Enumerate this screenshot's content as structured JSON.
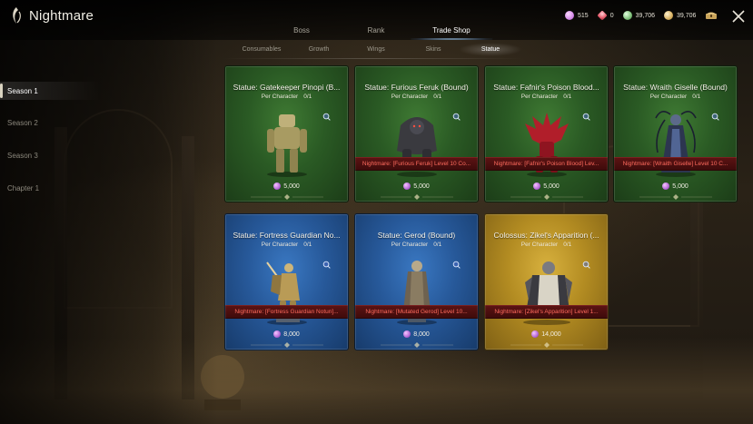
{
  "header": {
    "title": "Nightmare",
    "currencies": [
      {
        "icon": "pink-crystal-icon",
        "value": "515",
        "color": "#d58be8"
      },
      {
        "icon": "red-crystal-icon",
        "value": "0",
        "color": "#e45a6a"
      },
      {
        "icon": "green-coin-icon",
        "value": "39,706",
        "color": "#7fc07a"
      },
      {
        "icon": "gold-coin-icon",
        "value": "39,706",
        "color": "#d7b060"
      }
    ]
  },
  "main_tabs": [
    {
      "label": "Boss",
      "active": false
    },
    {
      "label": "Rank",
      "active": false
    },
    {
      "label": "Trade Shop",
      "active": true
    }
  ],
  "sub_tabs": [
    {
      "label": "Consumables",
      "active": false
    },
    {
      "label": "Growth",
      "active": false
    },
    {
      "label": "Wings",
      "active": false
    },
    {
      "label": "Skins",
      "active": false
    },
    {
      "label": "Statue",
      "active": true
    }
  ],
  "side_nav": [
    {
      "label": "Season 1",
      "active": true
    },
    {
      "label": "Season 2",
      "active": false
    },
    {
      "label": "Season 3",
      "active": false
    },
    {
      "label": "Chapter 1",
      "active": false
    }
  ],
  "items": [
    {
      "name": "Statue: Gatekeeper Pinopi (B...",
      "limit_label": "Per Character",
      "limit": "0/1",
      "requirement": "",
      "price": "5,000",
      "theme": "green",
      "figure": "golem-statue-icon"
    },
    {
      "name": "Statue: Furious Feruk (Bound)",
      "limit_label": "Per Character",
      "limit": "0/1",
      "requirement": "Nightmare: [Furious Feruk] Level 10 Co...",
      "price": "5,000",
      "theme": "green",
      "figure": "beast-statue-icon"
    },
    {
      "name": "Statue: Fafnir's Poison Blood...",
      "limit_label": "Per Character",
      "limit": "0/1",
      "requirement": "Nightmare: [Fafnir's Poison Blood] Lev...",
      "price": "5,000",
      "theme": "green",
      "figure": "red-demon-statue-icon"
    },
    {
      "name": "Statue: Wraith Giselle (Bound)",
      "limit_label": "Per Character",
      "limit": "0/1",
      "requirement": "Nightmare: [Wraith Giselle] Level 10 C...",
      "price": "5,000",
      "theme": "green",
      "figure": "wraith-statue-icon"
    },
    {
      "name": "Statue: Fortress Guardian No...",
      "limit_label": "Per Character",
      "limit": "0/1",
      "requirement": "Nightmare: [Fortress Guardian Notun]...",
      "price": "8,000",
      "theme": "blue",
      "figure": "guardian-statue-icon"
    },
    {
      "name": "Statue: Gerod (Bound)",
      "limit_label": "Per Character",
      "limit": "0/1",
      "requirement": "Nightmare: [Mutated Gerod] Level 10...",
      "price": "8,000",
      "theme": "blue",
      "figure": "robed-figure-statue-icon"
    },
    {
      "name": "Colossus: Zikel's Apparition (...",
      "limit_label": "Per Character",
      "limit": "0/1",
      "requirement": "Nightmare: [Zikel's Apparition] Level 1...",
      "price": "14,000",
      "theme": "gold",
      "figure": "colossus-statue-icon"
    }
  ]
}
